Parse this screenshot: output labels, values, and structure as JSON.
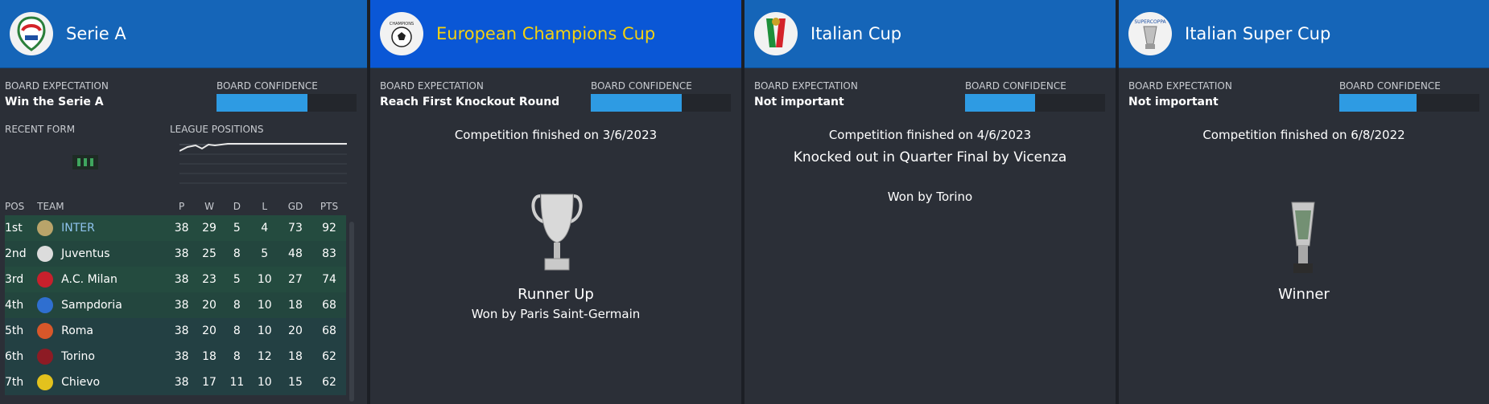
{
  "competitions": [
    {
      "name": "Serie A",
      "board_expectation_label": "BOARD EXPECTATION",
      "board_expectation": "Win the Serie A",
      "board_confidence_label": "BOARD CONFIDENCE",
      "board_confidence": 0.65,
      "recent_form_label": "RECENT FORM",
      "league_positions_label": "LEAGUE POSITIONS",
      "table_headers": [
        "POS",
        "TEAM",
        "P",
        "W",
        "D",
        "L",
        "GD",
        "PTS"
      ],
      "table": [
        {
          "pos": "1st",
          "team": "INTER",
          "p": "38",
          "w": "29",
          "d": "5",
          "l": "4",
          "gd": "73",
          "pts": "92",
          "badge": "#b9a46a"
        },
        {
          "pos": "2nd",
          "team": "Juventus",
          "p": "38",
          "w": "25",
          "d": "8",
          "l": "5",
          "gd": "48",
          "pts": "83",
          "badge": "#dcdcdc"
        },
        {
          "pos": "3rd",
          "team": "A.C. Milan",
          "p": "38",
          "w": "23",
          "d": "5",
          "l": "10",
          "gd": "27",
          "pts": "74",
          "badge": "#c8202c"
        },
        {
          "pos": "4th",
          "team": "Sampdoria",
          "p": "38",
          "w": "20",
          "d": "8",
          "l": "10",
          "gd": "18",
          "pts": "68",
          "badge": "#2f6fd0"
        },
        {
          "pos": "5th",
          "team": "Roma",
          "p": "38",
          "w": "20",
          "d": "8",
          "l": "10",
          "gd": "20",
          "pts": "68",
          "badge": "#d8572a"
        },
        {
          "pos": "6th",
          "team": "Torino",
          "p": "38",
          "w": "18",
          "d": "8",
          "l": "12",
          "gd": "18",
          "pts": "62",
          "badge": "#8d1b24"
        },
        {
          "pos": "7th",
          "team": "Chievo",
          "p": "38",
          "w": "17",
          "d": "11",
          "l": "10",
          "gd": "15",
          "pts": "62",
          "badge": "#e3c21d"
        }
      ]
    },
    {
      "name": "European Champions Cup",
      "board_expectation_label": "BOARD EXPECTATION",
      "board_expectation": "Reach First Knockout Round",
      "board_confidence_label": "BOARD CONFIDENCE",
      "board_confidence": 0.65,
      "finished": "Competition finished on 3/6/2023",
      "result": "Runner Up",
      "won_by": "Won by Paris Saint-Germain"
    },
    {
      "name": "Italian Cup",
      "board_expectation_label": "BOARD EXPECTATION",
      "board_expectation": "Not important",
      "board_confidence_label": "BOARD CONFIDENCE",
      "board_confidence": 0.5,
      "finished": "Competition finished on 4/6/2023",
      "knocked_out": "Knocked out in Quarter Final by Vicenza",
      "won_by": "Won by Torino"
    },
    {
      "name": "Italian Super Cup",
      "board_expectation_label": "BOARD EXPECTATION",
      "board_expectation": "Not important",
      "board_confidence_label": "BOARD CONFIDENCE",
      "board_confidence": 0.55,
      "finished": "Competition finished on 6/8/2022",
      "result": "Winner"
    }
  ],
  "colors": {
    "header": "#1565b8",
    "header_active": "#0a57d6",
    "active_title": "#f5d20f",
    "confidence_fill": "#2e9be3",
    "background": "#2b2f37"
  }
}
